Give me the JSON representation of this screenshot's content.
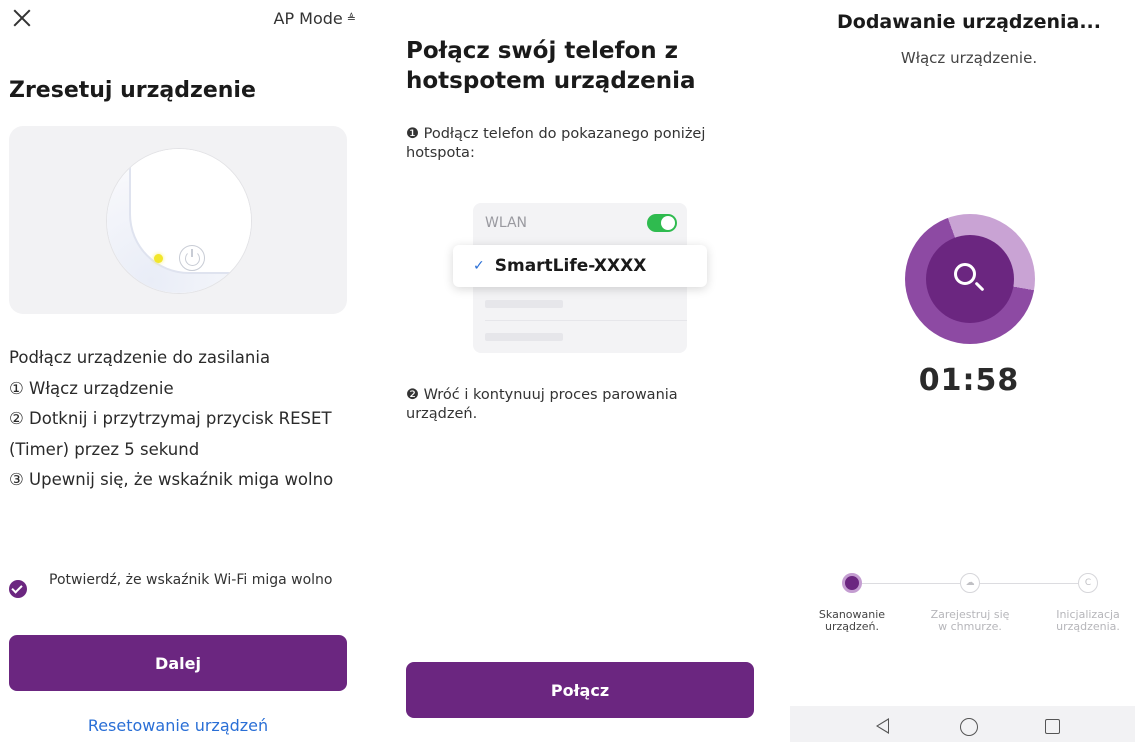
{
  "panel1": {
    "close_label": "×",
    "ap_mode": "AP Mode",
    "ap_mode_caret": "≜",
    "title": "Zresetuj urządzenie",
    "steps": [
      "Podłącz urządzenie do zasilania",
      "① Włącz urządzenie",
      "② Dotknij i przytrzymaj przycisk RESET",
      "(Timer) przez 5 sekund",
      "③ Upewnij się, że wskaźnik miga wolno"
    ],
    "confirm_text": "Potwierdź, że wskaźnik Wi-Fi miga wolno",
    "confirm_checked": true,
    "next_button": "Dalej",
    "reset_link": "Resetowanie urządzeń"
  },
  "panel2": {
    "title": "Połącz swój telefon z hotspotem urządzenia",
    "step1": "❶ Podłącz telefon do pokazanego poniżej hotspota:",
    "wlan_label": "WLAN",
    "wlan_enabled": true,
    "ssid_check": "✓",
    "ssid": "SmartLife-XXXX",
    "step2": "❷ Wróć i kontynuuj proces parowania urządzeń.",
    "connect_button": "Połącz"
  },
  "panel3": {
    "title": "Dodawanie urządzenia...",
    "subtitle": "Włącz urządzenie.",
    "timer": "01:58",
    "steps": [
      {
        "label": "Skanowanie urządzeń.",
        "state": "active"
      },
      {
        "label": "Zarejestruj się w chmurze.",
        "state": "idle",
        "icon": "☁"
      },
      {
        "label": "Inicjalizacja urządzenia.",
        "state": "idle",
        "icon": "C"
      }
    ],
    "accent_color": "#6b2680"
  }
}
